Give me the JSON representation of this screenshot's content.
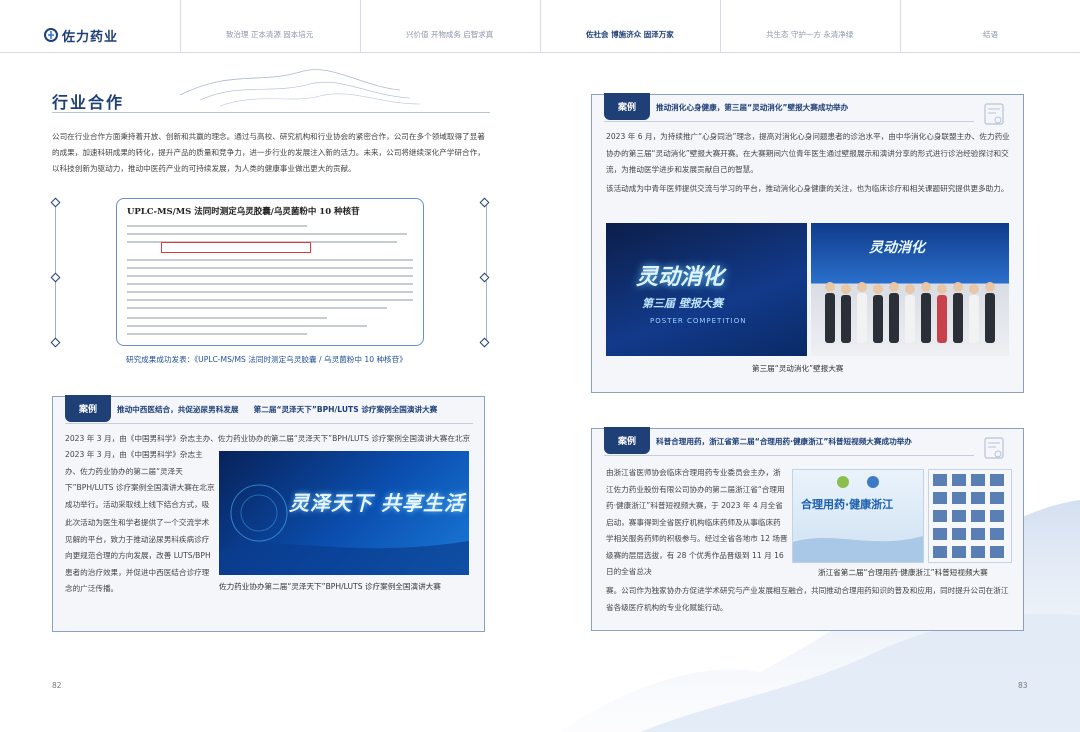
{
  "header": {
    "logo_text": "佐力药业",
    "nav": [
      {
        "label": "致治理 正本清源 固本培元"
      },
      {
        "label": "兴价值 开物成务 启智求真"
      },
      {
        "label": "佐社会 博施济众 固泽万家"
      },
      {
        "label": "共生态 守护一方 永清净绿"
      },
      {
        "label": "结语"
      }
    ]
  },
  "left_page": {
    "title": "行业合作",
    "intro": "公司在行业合作方面秉持着开放、创新和共赢的理念。通过与高校、研究机构和行业协会的紧密合作，公司在多个领域取得了显著的成果，加速科研成果的转化，提升产品的质量和竞争力，进一步行业的发展注入新的活力。未来，公司将继续深化产学研合作，以科技创新为驱动力，推动中医药产业的可持续发展，为人类的健康事业做出更大的贡献。",
    "paper": {
      "title": "UPLC-MS/MS 法同时测定乌灵胶囊/乌灵菌粉中 10 种核苷"
    },
    "paper_caption": "研究成果成功发表：《UPLC-MS/MS 法同时测定乌灵胶囊 / 乌灵菌粉中 10 种核苷》",
    "case1": {
      "tag": "案例",
      "headline": "推动中西医结合，共促泌尿男科发展　　第二届“灵泽天下”BPH/LUTS 诊疗案例全国演讲大赛",
      "para1": "2023 年 3 月，由《中国男科学》杂志主办、佐力药业协办的第二届“灵泽天下”BPH/LUTS 诊疗案例全国演讲大赛在北京成功举行。活动采取线上线下结合方式，吸引了多位教授专家参与，共同探讨 BPH/LUTS 诊疗领域的最新发展趋势。",
      "para2": "此次活动为医生和学者提供了一个交流学术见解的平台，致力于推动泌尿男科疾病诊疗向更规范合理的方向发展，改善 LUTS/BPH 患者的治疗效果，并促进中西医结合诊疗理念的广泛传播。",
      "image_text": "灵泽天下 共享生活",
      "caption": "佐力药业协办第二届“灵泽天下”BPH/LUTS 诊疗案例全国演讲大赛"
    },
    "page_number": "82"
  },
  "right_page": {
    "case2": {
      "tag": "案例",
      "headline": "推动消化心身健康，第三届“灵动消化”壁报大赛成功举办",
      "para1": "2023 年 6 月，为持续推广“心身同治”理念，提高对消化心身问题患者的诊治水平，由中华消化心身联盟主办、佐力药业协办的第三届“灵动消化”壁报大赛开赛。在大赛期间六位青年医生通过壁报展示和演讲分享的形式进行诊治经验探讨和交流，为推动医学进步和发展贡献自己的智慧。",
      "para2": "该活动成为中青年医师提供交流与学习的平台，推动消化心身健康的关注，也为临床诊疗和相关课题研究提供更多助力。",
      "image_text": "灵动消化",
      "image_sub": "第三届 壁报大赛",
      "image_en": "POSTER COMPETITION",
      "caption": "第三届“灵动消化”壁报大赛"
    },
    "case3": {
      "tag": "案例",
      "headline": "科普合理用药，浙江省第二届“合理用药·健康浙江”科普短视频大赛成功举办",
      "para1": "由浙江省医师协会临床合理用药专业委员会主办，浙江佐力药业股份有限公司协办的第二届浙江省“合理用药·健康浙江”科普短视频大赛，于 2023 年 4 月全省启动，赛事得到全省医疗机构临床药师及从事临床药学相关服务药师的积极参与。经过全省各地市 12 场晋级赛的层层选拔，有 28 个优秀作品晋级到 11 月 16 日的全省总决",
      "para2": "赛。公司作为独家协办方促进学术研究与产业发展相互融合，共同推动合理用药知识的普及和应用，同时提升公司在浙江省各级医疗机构的专业化赋能行动。",
      "image_text": "合理用药·健康浙江",
      "caption": "浙江省第二届“合理用药·健康浙江”科普短视频大赛"
    },
    "page_number": "83"
  }
}
